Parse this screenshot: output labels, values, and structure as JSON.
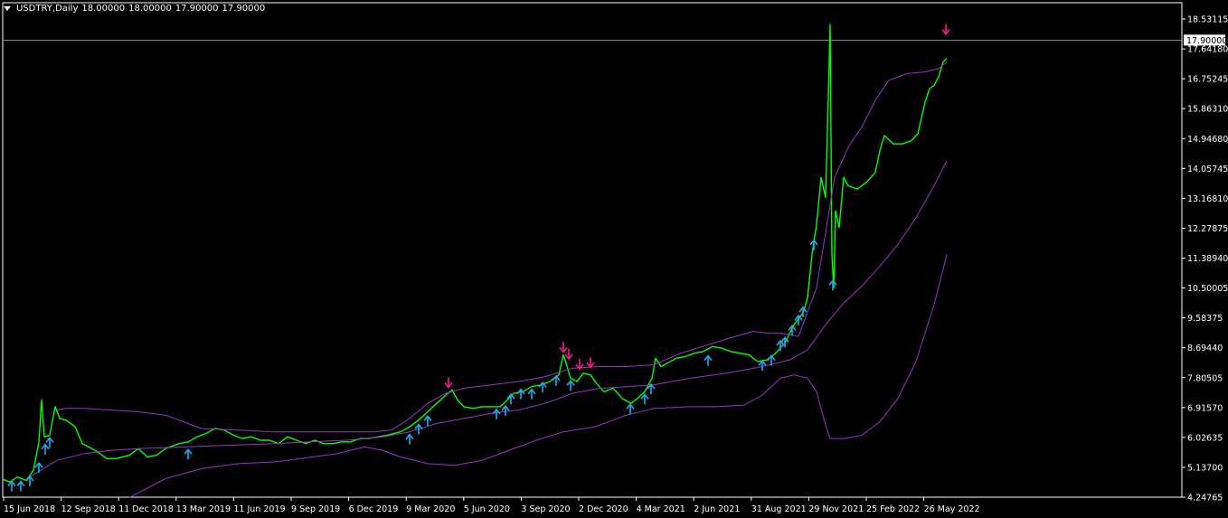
{
  "header": {
    "symbol_timeframe": "USDTRY,Daily",
    "ohlc": [
      "18.00000",
      "18.00000",
      "17.90000",
      "17.90000"
    ]
  },
  "colors": {
    "background": "#000000",
    "axis": "#FFFFFF",
    "price_line": "#00FF00",
    "bands": "#9933CC",
    "arrow_up": "#22AAEE",
    "arrow_down": "#FF1493",
    "current_price_line": "#AAAAAA"
  },
  "chart_data": {
    "type": "line",
    "title": "USDTRY,Daily",
    "y_ticks": [
      "18.53115",
      "17.64180",
      "16.75245",
      "15.86310",
      "14.94680",
      "14.05745",
      "13.16810",
      "12.27875",
      "11.38940",
      "10.50005",
      "9.58375",
      "8.69440",
      "7.80505",
      "6.91570",
      "6.02635",
      "5.13700",
      "4.24765"
    ],
    "x_ticks": [
      "15 Jun 2018",
      "12 Sep 2018",
      "11 Dec 2018",
      "13 Mar 2019",
      "11 Jun 2019",
      "9 Sep 2019",
      "6 Dec 2019",
      "9 Mar 2020",
      "5 Jun 2020",
      "3 Sep 2020",
      "2 Dec 2020",
      "4 Mar 2021",
      "2 Jun 2021",
      "31 Aug 2021",
      "29 Nov 2021",
      "25 Feb 2022",
      "26 May 2022"
    ],
    "ylim": [
      4.24765,
      18.53115
    ],
    "current_price": "17.90000",
    "series": [
      {
        "role": "price",
        "points": [
          [
            0,
            4.78
          ],
          [
            8,
            4.7
          ],
          [
            16,
            4.85
          ],
          [
            26,
            4.75
          ],
          [
            34,
            5.05
          ],
          [
            40,
            5.9
          ],
          [
            43,
            7.15
          ],
          [
            46,
            6.05
          ],
          [
            52,
            6.1
          ],
          [
            58,
            6.95
          ],
          [
            63,
            6.6
          ],
          [
            70,
            6.55
          ],
          [
            80,
            6.35
          ],
          [
            88,
            5.85
          ],
          [
            95,
            5.75
          ],
          [
            105,
            5.6
          ],
          [
            115,
            5.4
          ],
          [
            125,
            5.4
          ],
          [
            140,
            5.5
          ],
          [
            150,
            5.7
          ],
          [
            160,
            5.45
          ],
          [
            170,
            5.5
          ],
          [
            180,
            5.7
          ],
          [
            195,
            5.85
          ],
          [
            205,
            5.9
          ],
          [
            215,
            6.05
          ],
          [
            225,
            6.15
          ],
          [
            235,
            6.3
          ],
          [
            245,
            6.25
          ],
          [
            255,
            6.1
          ],
          [
            265,
            6.0
          ],
          [
            275,
            6.05
          ],
          [
            285,
            5.95
          ],
          [
            295,
            5.95
          ],
          [
            305,
            5.85
          ],
          [
            315,
            6.05
          ],
          [
            325,
            5.95
          ],
          [
            335,
            5.85
          ],
          [
            345,
            5.95
          ],
          [
            355,
            5.85
          ],
          [
            365,
            5.85
          ],
          [
            375,
            5.9
          ],
          [
            385,
            5.9
          ],
          [
            395,
            6.0
          ],
          [
            405,
            6.0
          ],
          [
            415,
            6.05
          ],
          [
            425,
            6.1
          ],
          [
            440,
            6.2
          ],
          [
            450,
            6.35
          ],
          [
            460,
            6.55
          ],
          [
            470,
            6.8
          ],
          [
            480,
            7.05
          ],
          [
            490,
            7.3
          ],
          [
            497,
            7.45
          ],
          [
            503,
            7.15
          ],
          [
            510,
            6.95
          ],
          [
            520,
            6.9
          ],
          [
            530,
            6.95
          ],
          [
            540,
            6.95
          ],
          [
            550,
            6.95
          ],
          [
            558,
            7.15
          ],
          [
            565,
            7.35
          ],
          [
            575,
            7.4
          ],
          [
            585,
            7.55
          ],
          [
            595,
            7.6
          ],
          [
            605,
            7.7
          ],
          [
            615,
            7.9
          ],
          [
            620,
            8.5
          ],
          [
            623,
            8.25
          ],
          [
            628,
            7.8
          ],
          [
            635,
            7.7
          ],
          [
            642,
            7.95
          ],
          [
            650,
            7.9
          ],
          [
            658,
            7.6
          ],
          [
            665,
            7.4
          ],
          [
            675,
            7.5
          ],
          [
            685,
            7.2
          ],
          [
            695,
            7.05
          ],
          [
            702,
            7.2
          ],
          [
            710,
            7.4
          ],
          [
            718,
            7.8
          ],
          [
            722,
            8.4
          ],
          [
            728,
            8.15
          ],
          [
            735,
            8.25
          ],
          [
            745,
            8.4
          ],
          [
            755,
            8.45
          ],
          [
            765,
            8.55
          ],
          [
            775,
            8.6
          ],
          [
            785,
            8.75
          ],
          [
            795,
            8.7
          ],
          [
            805,
            8.6
          ],
          [
            815,
            8.55
          ],
          [
            825,
            8.5
          ],
          [
            835,
            8.3
          ],
          [
            845,
            8.35
          ],
          [
            855,
            8.55
          ],
          [
            865,
            8.85
          ],
          [
            875,
            9.4
          ],
          [
            885,
            9.75
          ],
          [
            890,
            10.2
          ],
          [
            895,
            11.5
          ],
          [
            900,
            12.4
          ],
          [
            905,
            13.8
          ],
          [
            910,
            13.2
          ],
          [
            913,
            16.2
          ],
          [
            915,
            18.37
          ],
          [
            917,
            11.5
          ],
          [
            919,
            10.5
          ],
          [
            921,
            12.8
          ],
          [
            925,
            12.3
          ],
          [
            930,
            13.8
          ],
          [
            935,
            13.55
          ],
          [
            945,
            13.45
          ],
          [
            955,
            13.65
          ],
          [
            965,
            13.95
          ],
          [
            970,
            14.6
          ],
          [
            975,
            15.05
          ],
          [
            985,
            14.8
          ],
          [
            995,
            14.8
          ],
          [
            1005,
            14.9
          ],
          [
            1012,
            15.1
          ],
          [
            1020,
            16.05
          ],
          [
            1025,
            16.45
          ],
          [
            1030,
            16.55
          ],
          [
            1035,
            16.8
          ],
          [
            1040,
            17.25
          ],
          [
            1044,
            17.35
          ]
        ]
      },
      {
        "role": "upper-band",
        "points": [
          [
            60,
            6.85
          ],
          [
            70,
            6.9
          ],
          [
            90,
            6.9
          ],
          [
            120,
            6.85
          ],
          [
            150,
            6.8
          ],
          [
            180,
            6.7
          ],
          [
            200,
            6.5
          ],
          [
            220,
            6.3
          ],
          [
            260,
            6.25
          ],
          [
            300,
            6.2
          ],
          [
            340,
            6.2
          ],
          [
            380,
            6.2
          ],
          [
            410,
            6.2
          ],
          [
            430,
            6.25
          ],
          [
            450,
            6.6
          ],
          [
            470,
            7.05
          ],
          [
            490,
            7.35
          ],
          [
            510,
            7.5
          ],
          [
            540,
            7.6
          ],
          [
            570,
            7.7
          ],
          [
            600,
            7.85
          ],
          [
            630,
            8.1
          ],
          [
            660,
            8.15
          ],
          [
            690,
            8.15
          ],
          [
            720,
            8.2
          ],
          [
            750,
            8.55
          ],
          [
            780,
            8.8
          ],
          [
            810,
            9.05
          ],
          [
            830,
            9.2
          ],
          [
            845,
            9.15
          ],
          [
            860,
            9.15
          ],
          [
            880,
            9.05
          ],
          [
            900,
            10.5
          ],
          [
            920,
            13.8
          ],
          [
            935,
            14.7
          ],
          [
            950,
            15.3
          ],
          [
            965,
            16.1
          ],
          [
            980,
            16.7
          ],
          [
            1000,
            16.9
          ],
          [
            1020,
            16.95
          ],
          [
            1035,
            17.05
          ],
          [
            1044,
            17.25
          ]
        ]
      },
      {
        "role": "middle-band",
        "points": [
          [
            30,
            4.85
          ],
          [
            60,
            5.35
          ],
          [
            90,
            5.55
          ],
          [
            120,
            5.65
          ],
          [
            150,
            5.7
          ],
          [
            200,
            5.75
          ],
          [
            250,
            5.8
          ],
          [
            300,
            5.85
          ],
          [
            340,
            5.9
          ],
          [
            380,
            5.95
          ],
          [
            420,
            6.05
          ],
          [
            450,
            6.2
          ],
          [
            480,
            6.45
          ],
          [
            510,
            6.6
          ],
          [
            540,
            6.75
          ],
          [
            570,
            6.85
          ],
          [
            600,
            7.05
          ],
          [
            630,
            7.35
          ],
          [
            660,
            7.5
          ],
          [
            690,
            7.55
          ],
          [
            720,
            7.6
          ],
          [
            760,
            7.8
          ],
          [
            800,
            7.95
          ],
          [
            840,
            8.15
          ],
          [
            870,
            8.35
          ],
          [
            890,
            8.65
          ],
          [
            910,
            9.4
          ],
          [
            930,
            10.05
          ],
          [
            950,
            10.55
          ],
          [
            970,
            11.15
          ],
          [
            990,
            11.8
          ],
          [
            1010,
            12.6
          ],
          [
            1030,
            13.55
          ],
          [
            1044,
            14.3
          ]
        ]
      },
      {
        "role": "lower-band",
        "points": [
          [
            140,
            4.24
          ],
          [
            180,
            4.8
          ],
          [
            220,
            5.1
          ],
          [
            260,
            5.25
          ],
          [
            300,
            5.3
          ],
          [
            330,
            5.4
          ],
          [
            370,
            5.55
          ],
          [
            400,
            5.75
          ],
          [
            420,
            5.65
          ],
          [
            440,
            5.45
          ],
          [
            470,
            5.25
          ],
          [
            500,
            5.2
          ],
          [
            530,
            5.35
          ],
          [
            560,
            5.65
          ],
          [
            590,
            5.95
          ],
          [
            620,
            6.2
          ],
          [
            655,
            6.35
          ],
          [
            690,
            6.7
          ],
          [
            720,
            6.9
          ],
          [
            760,
            6.95
          ],
          [
            790,
            6.95
          ],
          [
            820,
            7.0
          ],
          [
            840,
            7.3
          ],
          [
            860,
            7.8
          ],
          [
            875,
            7.9
          ],
          [
            890,
            7.8
          ],
          [
            900,
            7.4
          ],
          [
            910,
            6.4
          ],
          [
            915,
            6.0
          ],
          [
            930,
            6.0
          ],
          [
            950,
            6.1
          ],
          [
            970,
            6.5
          ],
          [
            990,
            7.2
          ],
          [
            1010,
            8.3
          ],
          [
            1030,
            10.0
          ],
          [
            1044,
            11.5
          ]
        ]
      }
    ],
    "up_arrows": [
      [
        10,
        4.8
      ],
      [
        20,
        4.8
      ],
      [
        30,
        4.95
      ],
      [
        40,
        5.35
      ],
      [
        47,
        5.9
      ],
      [
        52,
        6.1
      ],
      [
        205,
        5.75
      ],
      [
        450,
        6.2
      ],
      [
        460,
        6.5
      ],
      [
        470,
        6.75
      ],
      [
        546,
        6.95
      ],
      [
        556,
        7.05
      ],
      [
        562,
        7.4
      ],
      [
        573,
        7.55
      ],
      [
        585,
        7.55
      ],
      [
        597,
        7.75
      ],
      [
        612,
        7.95
      ],
      [
        628,
        7.8
      ],
      [
        694,
        7.1
      ],
      [
        710,
        7.4
      ],
      [
        717,
        7.7
      ],
      [
        780,
        8.55
      ],
      [
        840,
        8.4
      ],
      [
        850,
        8.55
      ],
      [
        860,
        9.0
      ],
      [
        865,
        9.1
      ],
      [
        873,
        9.45
      ],
      [
        880,
        9.75
      ],
      [
        885,
        10.0
      ],
      [
        897,
        12.0
      ],
      [
        918,
        10.8
      ]
    ],
    "down_arrows": [
      [
        493,
        7.45
      ],
      [
        620,
        8.5
      ],
      [
        626,
        8.3
      ],
      [
        638,
        8.0
      ],
      [
        650,
        8.05
      ],
      [
        1043,
        18.0
      ]
    ]
  }
}
